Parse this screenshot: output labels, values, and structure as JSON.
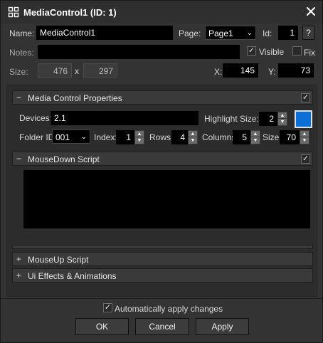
{
  "window": {
    "title": "MediaControl1 (ID: 1)",
    "icon": "grid-icon",
    "close_icon": "close-icon"
  },
  "header": {
    "name_label": "Name:",
    "name_value": "MediaControl1",
    "page_label": "Page:",
    "page_value": "Page1",
    "id_label": "Id:",
    "id_value": "1",
    "help_label": "?",
    "notes_label": "Notes:",
    "notes_value": "",
    "visible_label": "Visible",
    "visible_checked": true,
    "fix_label": "Fix",
    "fix_checked": false,
    "size_label": "Size:",
    "size_w": "476",
    "size_x": "x",
    "size_h": "297",
    "x_label": "X:",
    "x_value": "145",
    "y_label": "Y:",
    "y_value": "73"
  },
  "media_control": {
    "section_title": "Media Control Properties",
    "section_sign": "−",
    "enabled": true,
    "devices_label": "Devices:",
    "devices_value": "2.1",
    "highlight_label": "Highlight Size:",
    "highlight_value": "2",
    "highlight_color": "#0a6fd6",
    "folder_label": "Folder ID:",
    "folder_value": "001",
    "index_label": "Index:",
    "index_value": "1",
    "rows_label": "Rows:",
    "rows_value": "4",
    "columns_label": "Columns:",
    "columns_value": "5",
    "size_label": "Size:",
    "size_value": "70"
  },
  "mousedown": {
    "section_title": "MouseDown Script",
    "section_sign": "−",
    "enabled": true,
    "script": ""
  },
  "mouseup": {
    "section_title": "MouseUp Script",
    "section_sign": "+"
  },
  "effects": {
    "section_title": "Ui Effects & Animations",
    "section_sign": "+"
  },
  "footer": {
    "auto_apply_label": "Automatically apply changes",
    "auto_apply_checked": true,
    "ok_label": "OK",
    "cancel_label": "Cancel",
    "apply_label": "Apply"
  }
}
